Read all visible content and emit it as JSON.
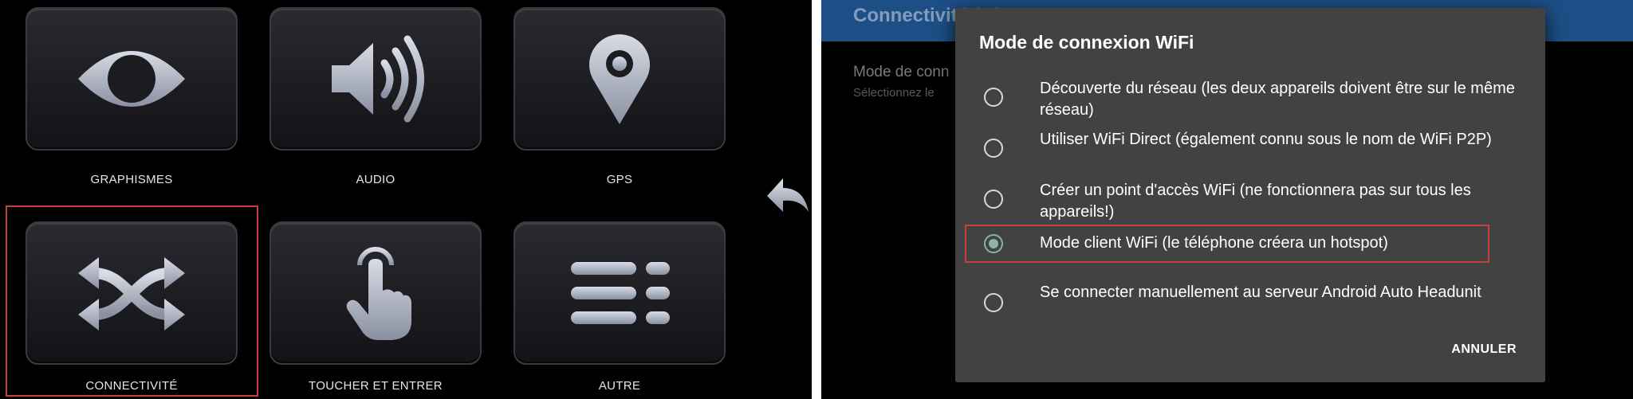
{
  "left": {
    "tiles": [
      {
        "label": "GRAPHISMES",
        "icon": "eye-icon"
      },
      {
        "label": "AUDIO",
        "icon": "speaker-icon"
      },
      {
        "label": "GPS",
        "icon": "location-pin-icon"
      },
      {
        "label": "CONNECTIVITÉ",
        "icon": "shuffle-arrows-icon"
      },
      {
        "label": "TOUCHER ET ENTRER",
        "icon": "touch-hand-icon"
      },
      {
        "label": "AUTRE",
        "icon": "list-icon"
      }
    ],
    "selected_tile": "CONNECTIVITÉ",
    "back_icon": "back-arrow-icon"
  },
  "right": {
    "app_bar_title": "Connectivité (...)",
    "setting_title": "Mode de conn",
    "setting_subtitle": "Sélectionnez le",
    "dialog": {
      "title": "Mode de connexion WiFi",
      "options": [
        {
          "label": "Découverte du réseau (les deux appareils doivent être sur le même réseau)",
          "selected": false
        },
        {
          "label": "Utiliser WiFi Direct (également connu sous le nom de WiFi P2P)",
          "selected": false
        },
        {
          "label": "Créer un point d'accès WiFi (ne fonctionnera pas sur tous les appareils!)",
          "selected": false
        },
        {
          "label": "Mode client WiFi (le téléphone créera un hotspot)",
          "selected": true
        },
        {
          "label": "Se connecter manuellement au serveur Android Auto Headunit",
          "selected": false
        }
      ],
      "cancel_label": "ANNULER"
    }
  },
  "colors": {
    "highlight_frame": "#c9403a",
    "radio_checked": "#8ab3a8",
    "dialog_bg": "#424242",
    "app_bar": "#1d4f86"
  }
}
